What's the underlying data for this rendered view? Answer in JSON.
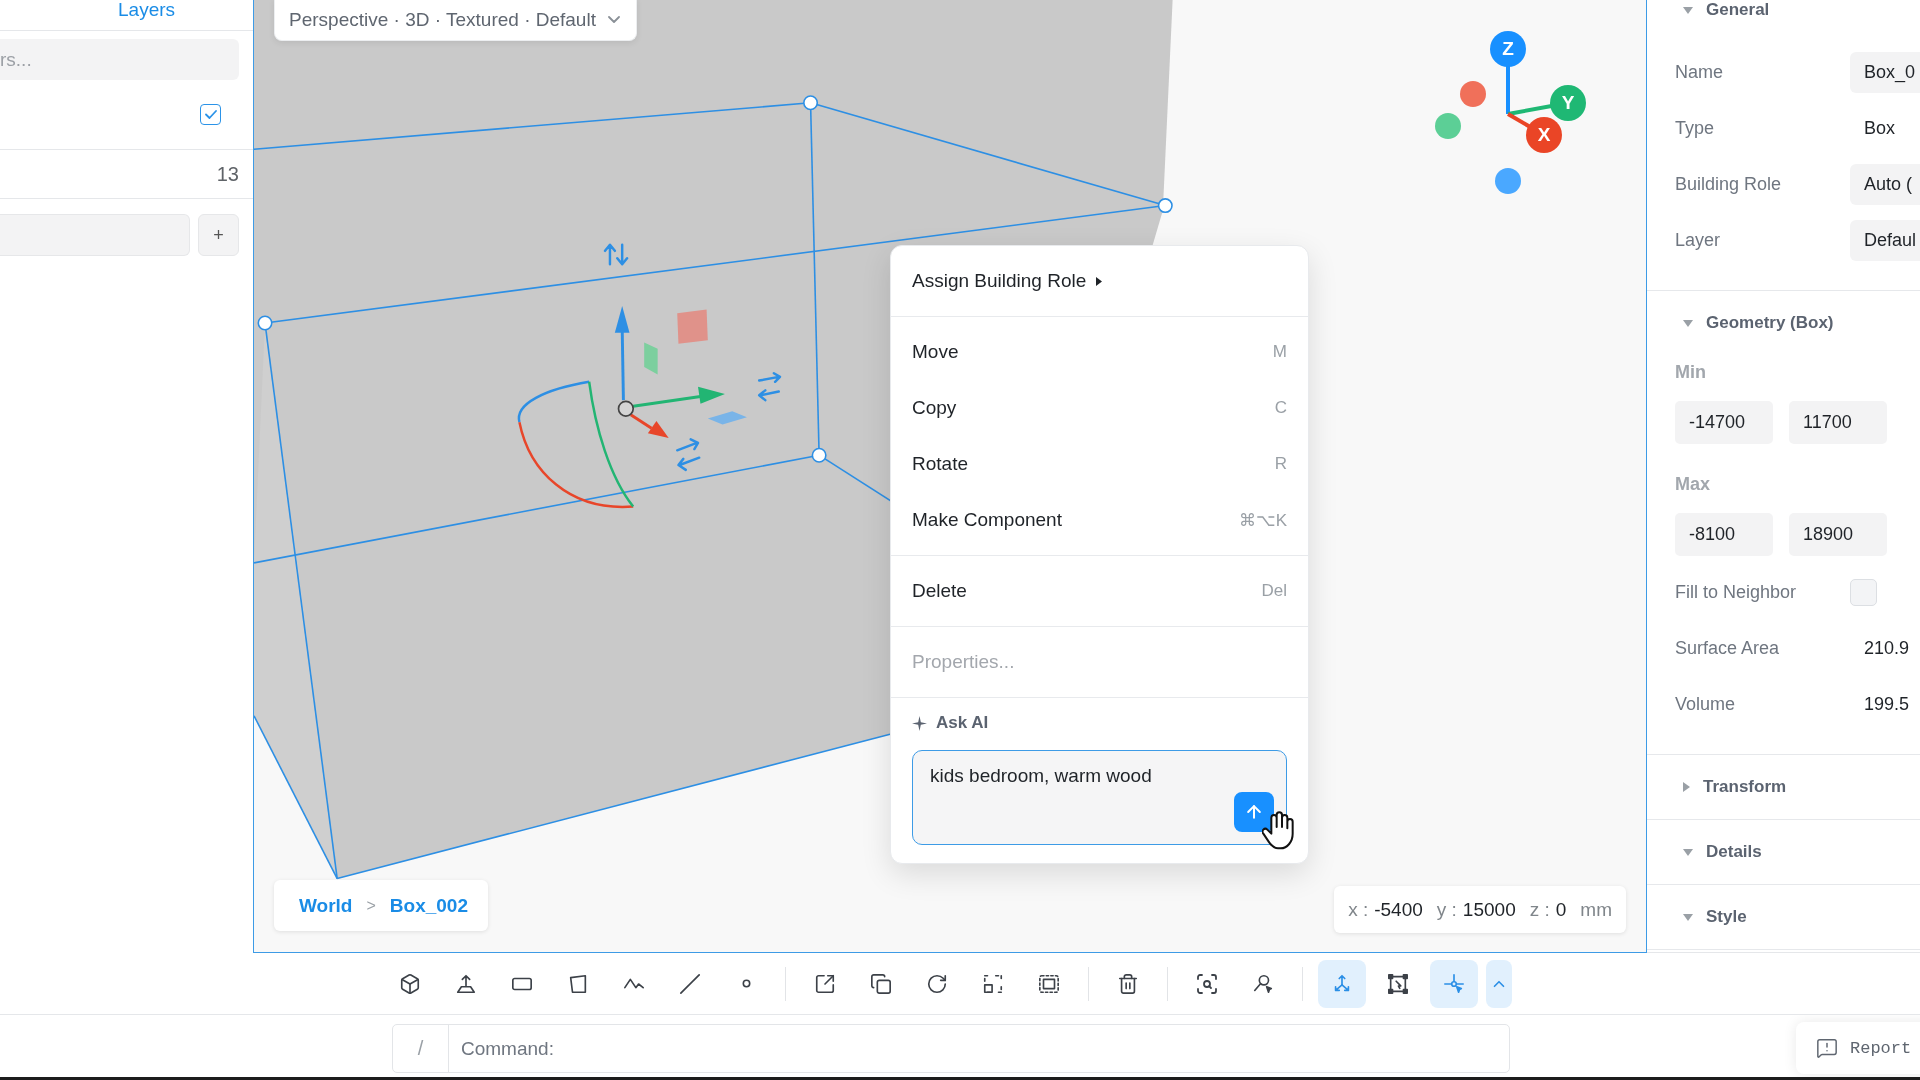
{
  "layers_panel": {
    "tabs": [
      {
        "label": "Layers",
        "selected": true
      }
    ],
    "search": {
      "placeholder": "rs..."
    },
    "checkbox_row": {
      "checked": true
    },
    "count_row": {
      "count": "13"
    },
    "add_row": {
      "button": "+"
    }
  },
  "viewport": {
    "view_menu": {
      "label": "Perspective · 3D · Textured · Default"
    },
    "axis_gizmo": {
      "axes": [
        {
          "label": "Z",
          "color": "#1890ff"
        },
        {
          "label": "Y",
          "color": "#1fb874"
        },
        {
          "label": "X",
          "color": "#ea4526"
        }
      ],
      "negative_axes": [
        {
          "color": "#f0705a"
        },
        {
          "color": "#5ccf96"
        },
        {
          "color": "#4aa8ff"
        }
      ]
    },
    "context_menu": {
      "groups": [
        [
          {
            "label": "Assign Building Role",
            "submenu": true,
            "disabled": false
          }
        ],
        [
          {
            "label": "Move",
            "shortcut": "M",
            "submenu": false,
            "disabled": false
          },
          {
            "label": "Copy",
            "shortcut": "C",
            "submenu": false,
            "disabled": false
          },
          {
            "label": "Rotate",
            "shortcut": "R",
            "submenu": false,
            "disabled": false
          },
          {
            "label": "Make Component",
            "shortcut": "⌘⌥K",
            "submenu": false,
            "disabled": false
          }
        ],
        [
          {
            "label": "Delete",
            "shortcut": "Del",
            "submenu": false,
            "disabled": false
          }
        ],
        [
          {
            "label": "Properties...",
            "submenu": false,
            "disabled": true
          }
        ]
      ],
      "ask_ai": {
        "label": "Ask AI",
        "value": "kids bedroom, warm wood",
        "focused": true
      }
    },
    "breadcrumb": {
      "items": [
        "World",
        "Box_002"
      ],
      "separator": ">"
    },
    "cursor_readout": {
      "coordinates": [
        {
          "label": "x :",
          "value": "-5400"
        },
        {
          "label": "y :",
          "value": "15000"
        },
        {
          "label": "z :",
          "value": "0"
        }
      ],
      "unit": "mm"
    }
  },
  "properties_panel": {
    "sections": [
      {
        "title": "General",
        "expanded": true,
        "rows": [
          {
            "kind": "field",
            "label": "Name",
            "value": "Box_0"
          },
          {
            "kind": "text",
            "label": "Type",
            "value": "Box"
          },
          {
            "kind": "field",
            "label": "Building Role",
            "value": "Auto ("
          },
          {
            "kind": "field",
            "label": "Layer",
            "value": "Defaul"
          }
        ]
      },
      {
        "title": "Geometry (Box)",
        "expanded": true,
        "rows": [
          {
            "kind": "vector",
            "label": "Min",
            "fields": [
              {
                "value": "-14700"
              },
              {
                "value": "11700"
              }
            ]
          },
          {
            "kind": "vector",
            "label": "Max",
            "fields": [
              {
                "value": "-8100"
              },
              {
                "value": "18900"
              }
            ]
          },
          {
            "kind": "checkbox",
            "label": "Fill to Neighbor",
            "checked": false
          },
          {
            "kind": "text",
            "label": "Surface Area",
            "value": "210.9"
          },
          {
            "kind": "text",
            "label": "Volume",
            "value": "199.5"
          }
        ]
      },
      {
        "title": "Transform",
        "expanded": false
      },
      {
        "title": "Details",
        "expanded": true
      },
      {
        "title": "Style",
        "expanded": true
      }
    ]
  },
  "toolbar": {
    "groups": [
      [
        {
          "kind": "cube",
          "active": false
        },
        {
          "kind": "extrude",
          "active": false
        },
        {
          "kind": "rectangle",
          "active": false
        },
        {
          "kind": "polygon",
          "active": false
        },
        {
          "kind": "polyline",
          "active": false
        },
        {
          "kind": "line",
          "active": false
        },
        {
          "kind": "point",
          "active": false
        }
      ],
      [
        {
          "kind": "push",
          "active": false
        },
        {
          "kind": "copy",
          "active": false
        },
        {
          "kind": "rotate",
          "active": false
        },
        {
          "kind": "scale",
          "active": false
        },
        {
          "kind": "group",
          "active": false
        }
      ],
      [
        {
          "kind": "delete",
          "active": false
        }
      ],
      [
        {
          "kind": "zoom",
          "active": false
        },
        {
          "kind": "find",
          "active": false
        }
      ],
      [
        {
          "kind": "axes",
          "active": true
        },
        {
          "kind": "bounds",
          "active": false
        },
        {
          "kind": "snap",
          "active": true
        },
        {
          "kind": "more",
          "active": true
        }
      ]
    ]
  },
  "command_bar": {
    "prefix": "/",
    "placeholder": "Command:",
    "report_button": "Report"
  }
}
